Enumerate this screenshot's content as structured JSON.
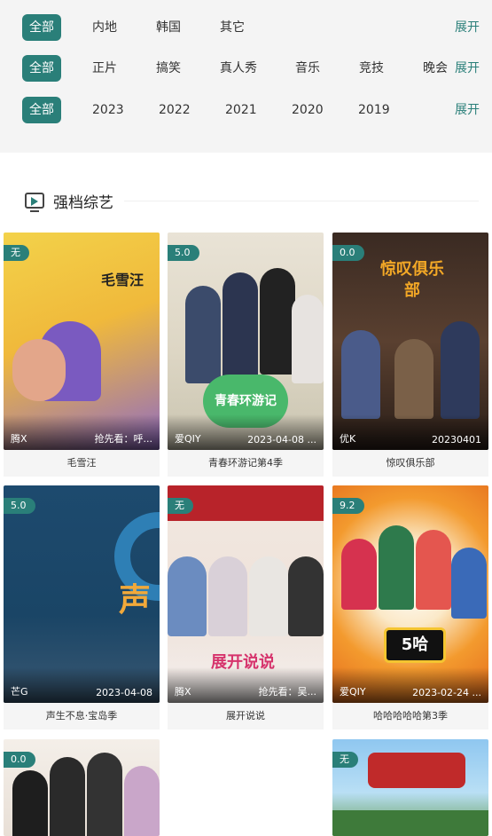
{
  "filters": {
    "expand_label": "展开",
    "region": [
      "全部",
      "内地",
      "韩国",
      "其它"
    ],
    "genre": [
      "全部",
      "正片",
      "搞笑",
      "真人秀",
      "音乐",
      "竞技",
      "晚会"
    ],
    "year": [
      "全部",
      "2023",
      "2022",
      "2021",
      "2020",
      "2019"
    ]
  },
  "section": {
    "title": "强档综艺",
    "icon": "tv-play-icon"
  },
  "cards": [
    {
      "title": "毛雪汪",
      "badge": "无",
      "source": "腾X",
      "info": "抢先看：呼...",
      "poster_text": "毛雪汪"
    },
    {
      "title": "青春环游记第4季",
      "badge": "5.0",
      "source": "爱QIY",
      "info": "2023-04-08 ...",
      "poster_text": "青春环游记"
    },
    {
      "title": "惊叹俱乐部",
      "badge": "0.0",
      "source": "优K",
      "info": "20230401",
      "poster_text": "惊叹俱乐部"
    },
    {
      "title": "声生不息·宝岛季",
      "badge": "5.0",
      "source": "芒G",
      "info": "2023-04-08",
      "poster_text": "声"
    },
    {
      "title": "展开说说",
      "badge": "无",
      "source": "腾X",
      "info": "抢先看：吴...",
      "poster_text": "展开说说"
    },
    {
      "title": "哈哈哈哈哈第3季",
      "badge": "9.2",
      "source": "爱QIY",
      "info": "2023-02-24 ...",
      "poster_text": "5哈"
    },
    {
      "title": "",
      "badge": "0.0",
      "source": "",
      "info": "",
      "poster_text": ""
    },
    {
      "title": "",
      "badge": "无",
      "source": "",
      "info": "",
      "poster_text": ""
    }
  ],
  "colors": {
    "accent": "#2a7f79",
    "filter_bg": "#f4f4f4",
    "title_bg": "#f5f5f5"
  }
}
